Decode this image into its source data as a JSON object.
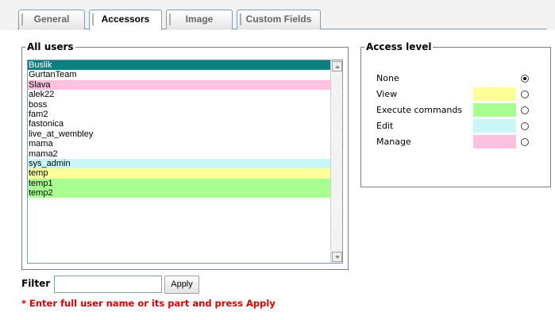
{
  "tabs": [
    {
      "label": "General"
    },
    {
      "label": "Accessors"
    },
    {
      "label": "Image"
    },
    {
      "label": "Custom Fields"
    }
  ],
  "active_tab": "Accessors",
  "all_users": {
    "legend": "All users",
    "items": [
      {
        "label": "Buslik",
        "bg": "#0f8080",
        "fg": "#ffffff"
      },
      {
        "label": "GurtanTeam",
        "bg": "#ffffff",
        "fg": "#000000"
      },
      {
        "label": "Slava",
        "bg": "#ffc1df",
        "fg": "#000000"
      },
      {
        "label": "alek22",
        "bg": "#ffffff",
        "fg": "#000000"
      },
      {
        "label": "boss",
        "bg": "#ffffff",
        "fg": "#000000"
      },
      {
        "label": "fam2",
        "bg": "#ffffff",
        "fg": "#000000"
      },
      {
        "label": "fastonica",
        "bg": "#ffffff",
        "fg": "#000000"
      },
      {
        "label": "live_at_wembley",
        "bg": "#ffffff",
        "fg": "#000000"
      },
      {
        "label": "mama",
        "bg": "#ffffff",
        "fg": "#000000"
      },
      {
        "label": "mama2",
        "bg": "#ffffff",
        "fg": "#000000"
      },
      {
        "label": "sys_admin",
        "bg": "#c9f7f7",
        "fg": "#000000"
      },
      {
        "label": "temp",
        "bg": "#ffff99",
        "fg": "#000000"
      },
      {
        "label": "temp1",
        "bg": "#aaff91",
        "fg": "#000000"
      },
      {
        "label": "temp2",
        "bg": "#aaff91",
        "fg": "#000000"
      }
    ]
  },
  "access_level": {
    "legend": "Access level",
    "levels": [
      {
        "label": "None",
        "color": "",
        "checked": true
      },
      {
        "label": "View",
        "color": "#ffff99",
        "checked": false
      },
      {
        "label": "Execute commands",
        "color": "#aaff91",
        "checked": false
      },
      {
        "label": "Edit",
        "color": "#c9f7f7",
        "checked": false
      },
      {
        "label": "Manage",
        "color": "#ffc1df",
        "checked": false
      }
    ]
  },
  "filter": {
    "label": "Filter",
    "value": "",
    "placeholder": "",
    "apply_label": "Apply",
    "hint": "* Enter full user name or its part and press Apply"
  }
}
